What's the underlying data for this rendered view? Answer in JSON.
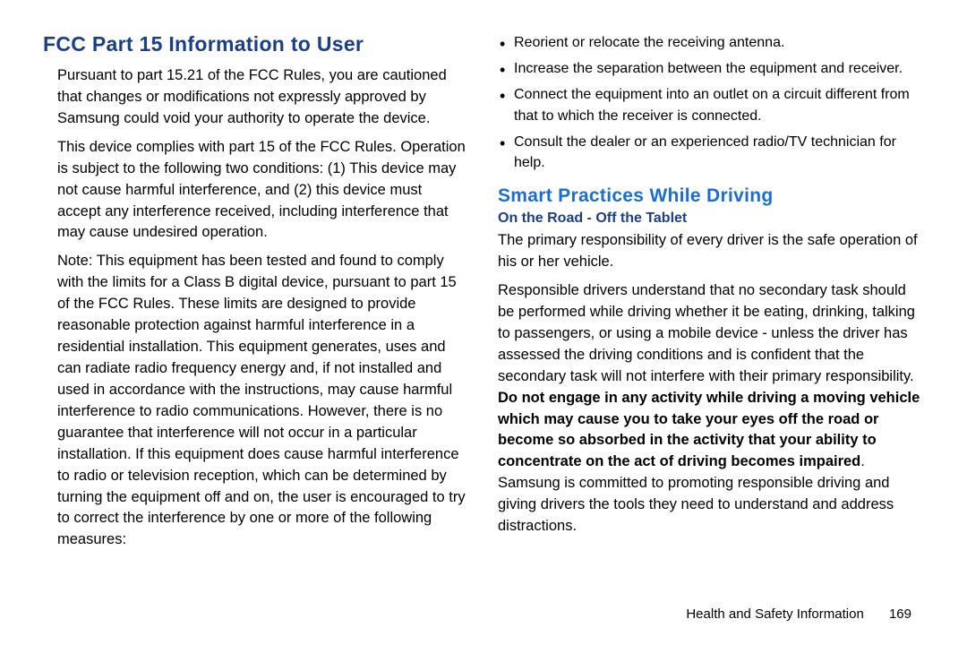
{
  "left": {
    "heading": "FCC Part 15 Information to User",
    "p1": "Pursuant to part 15.21 of the FCC Rules, you are cautioned that changes or modifications not expressly approved by Samsung could void your authority to operate the device.",
    "p2": "This device complies with part 15 of the FCC Rules. Operation is subject to the following two conditions: (1) This device may not cause harmful interference, and (2) this device must accept any interference received, including interference that may cause undesired operation.",
    "p3": "Note: This equipment has been tested and found to comply with the limits for a Class B digital device, pursuant to part 15 of the FCC Rules. These limits are designed to provide reasonable protection against harmful interference in a residential installation. This equipment generates, uses and can radiate radio frequency energy and, if not installed and used in accordance with the instructions, may cause harmful interference to radio communications. However, there is no guarantee that interference will not occur in a particular installation. If this equipment does cause harmful interference to radio or television reception, which can be determined by turning the equipment off and on, the user is encouraged to try to correct the interference by one or more of the following measures:"
  },
  "right": {
    "bullets": [
      "Reorient or relocate the receiving antenna.",
      "Increase the separation between the equipment and receiver.",
      "Connect the equipment into an outlet on a circuit different from that to which the receiver is connected.",
      "Consult the dealer or an experienced radio/TV technician for help."
    ],
    "heading2": "Smart Practices While Driving",
    "heading3": "On the Road - Off the Tablet",
    "p4": "The primary responsibility of every driver is the safe operation of his or her vehicle.",
    "p5_a": "Responsible drivers understand that no secondary task should be performed while driving whether it be eating, drinking, talking to passengers, or using a mobile device - unless the driver has assessed the driving conditions and is confident that the secondary task will not interfere with their primary responsibility. ",
    "p5_bold": "Do not engage in any activity while driving a moving vehicle which may cause you to take your eyes off the road or become so absorbed in the activity that your ability to concentrate on the act of driving becomes impaired",
    "p5_b": ". Samsung is committed to promoting responsible driving and giving drivers the tools they need to understand and address distractions."
  },
  "footer": {
    "text": "Health and Safety Information",
    "page": "169"
  }
}
